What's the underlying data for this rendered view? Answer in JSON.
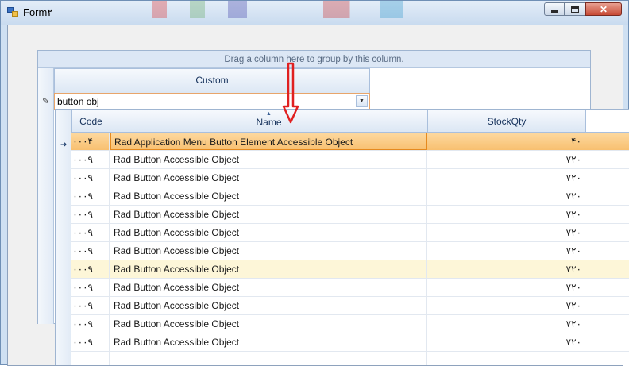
{
  "window": {
    "title": "Form۲",
    "controls": {
      "minimize": "minimize",
      "maximize": "maximize",
      "close": "✕"
    }
  },
  "grid": {
    "group_panel_text": "Drag a column here to group by this column.",
    "column_header": "Custom",
    "filter": {
      "value": "button obj",
      "dropdown_icon": "chevron-down-icon"
    }
  },
  "popup": {
    "headers": {
      "code": "Code",
      "name": "Name",
      "stock_qty": "StockQty"
    },
    "sort_indicator": "▲",
    "rows": [
      {
        "code": "۰۰۰۴",
        "name": "Rad Application Menu Button Element Accessible Object",
        "qty": "۴۰",
        "state": "current"
      },
      {
        "code": "۰۰۰۹",
        "name": "Rad Button Accessible Object",
        "qty": "۷۲۰",
        "state": ""
      },
      {
        "code": "۰۰۰۹",
        "name": "Rad Button Accessible Object",
        "qty": "۷۲۰",
        "state": ""
      },
      {
        "code": "۰۰۰۹",
        "name": "Rad Button Accessible Object",
        "qty": "۷۲۰",
        "state": ""
      },
      {
        "code": "۰۰۰۹",
        "name": "Rad Button Accessible Object",
        "qty": "۷۲۰",
        "state": ""
      },
      {
        "code": "۰۰۰۹",
        "name": "Rad Button Accessible Object",
        "qty": "۷۲۰",
        "state": ""
      },
      {
        "code": "۰۰۰۹",
        "name": "Rad Button Accessible Object",
        "qty": "۷۲۰",
        "state": ""
      },
      {
        "code": "۰۰۰۹",
        "name": "Rad Button Accessible Object",
        "qty": "۷۲۰",
        "state": "hover"
      },
      {
        "code": "۰۰۰۹",
        "name": "Rad Button Accessible Object",
        "qty": "۷۲۰",
        "state": ""
      },
      {
        "code": "۰۰۰۹",
        "name": "Rad Button Accessible Object",
        "qty": "۷۲۰",
        "state": ""
      },
      {
        "code": "۰۰۰۹",
        "name": "Rad Button Accessible Object",
        "qty": "۷۲۰",
        "state": ""
      },
      {
        "code": "۰۰۰۹",
        "name": "Rad Button Accessible Object",
        "qty": "۷۲۰",
        "state": ""
      },
      {
        "code": "",
        "name": "",
        "qty": "",
        "state": ""
      }
    ]
  },
  "colors": {
    "annotation_arrow": "#e02020",
    "current_row": "#f8c070",
    "hover_row": "#fdf6d8"
  }
}
